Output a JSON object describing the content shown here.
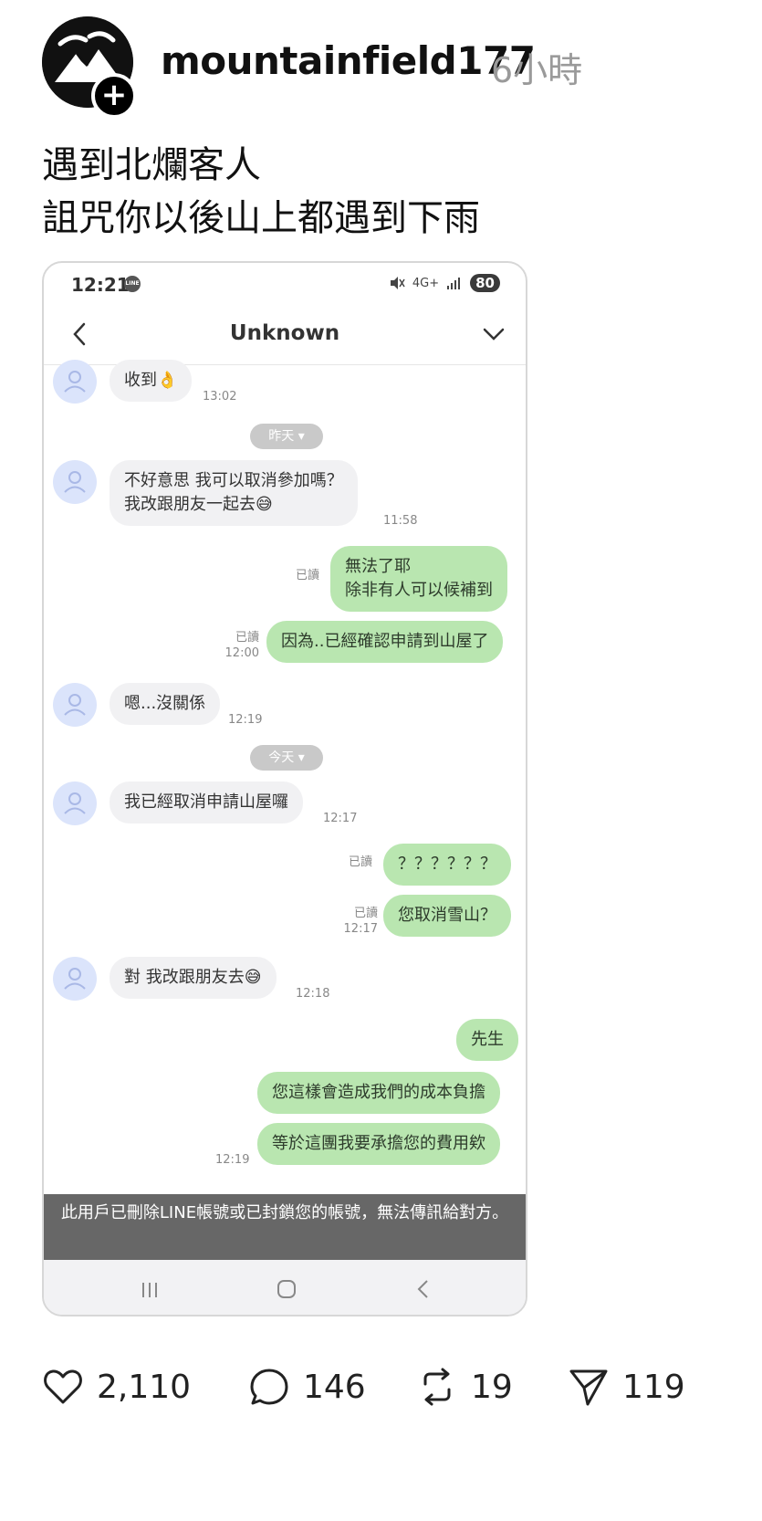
{
  "post": {
    "username": "mountainfield177",
    "time": "6小時",
    "text_line1": "遇到北爛客人",
    "text_line2": "詛咒你以後山上都遇到下雨"
  },
  "phone": {
    "status_time": "12:21",
    "status_line_badge": "LINE",
    "network": "4G+",
    "battery": "80",
    "chat_title": "Unknown",
    "toast": "此用戶已刪除LINE帳號或已封鎖您的帳號，無法傳訊給對方。",
    "date_yesterday": "昨天",
    "date_today": "今天",
    "read_label": "已讀",
    "messages": [
      {
        "dir": "in",
        "text": "收到👌",
        "time": "13:02"
      },
      {
        "dir": "in",
        "line1": "不好意思 我可以取消參加嗎？",
        "line2": "我改跟朋友一起去😅",
        "time": "11:58"
      },
      {
        "dir": "out",
        "line1": "無法了耶",
        "line2": "除非有人可以候補到",
        "read": "已讀"
      },
      {
        "dir": "out",
        "text": "因為..已經確認申請到山屋了",
        "read": "已讀",
        "time": "12:00"
      },
      {
        "dir": "in",
        "text": "嗯...沒關係",
        "time": "12:19"
      },
      {
        "dir": "in",
        "text": "我已經取消申請山屋囉",
        "time": "12:17"
      },
      {
        "dir": "out",
        "text": "？？？？？？",
        "read": "已讀"
      },
      {
        "dir": "out",
        "text": "您取消雪山？",
        "read": "已讀",
        "time": "12:17"
      },
      {
        "dir": "in",
        "text": "對 我改跟朋友去😅",
        "time": "12:18"
      },
      {
        "dir": "out",
        "text": "先生"
      },
      {
        "dir": "out",
        "text": "您這樣會造成我們的成本負擔"
      },
      {
        "dir": "out",
        "text": "等於這團我要承擔您的費用欸",
        "time": "12:19"
      }
    ]
  },
  "actions": {
    "likes": "2,110",
    "comments": "146",
    "reposts": "19",
    "shares": "119"
  },
  "colors": {
    "bubble_out": "#b9e6b0",
    "bubble_in": "#f1f1f3",
    "avatar_placeholder": "#dbe4fb"
  }
}
